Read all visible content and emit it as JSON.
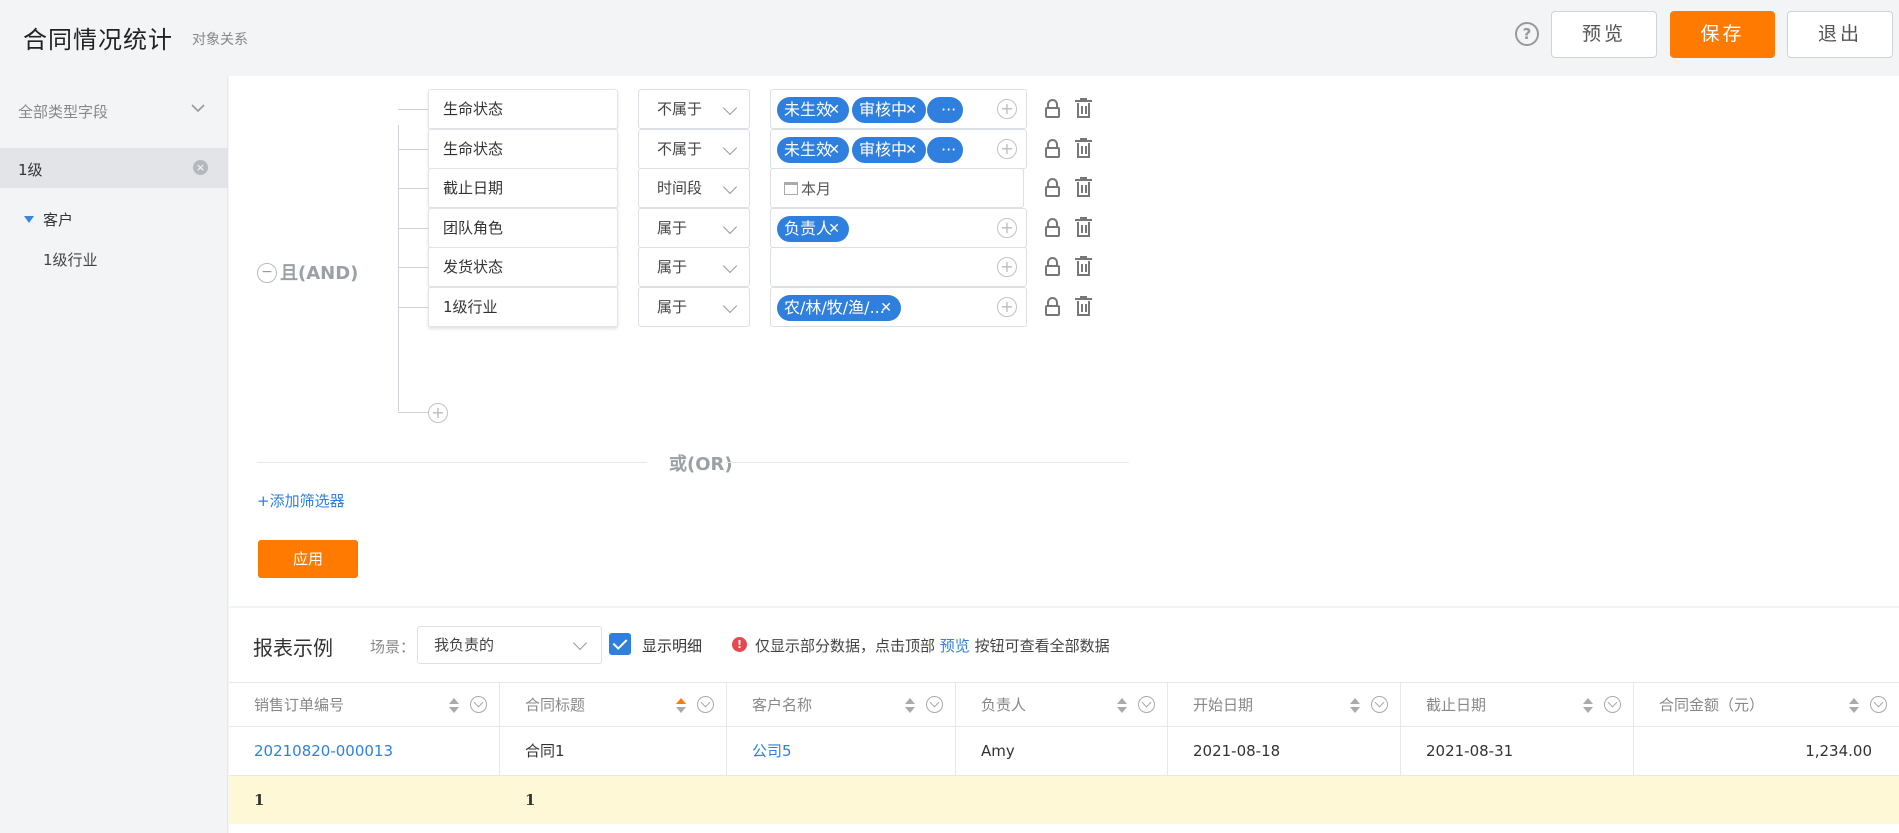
{
  "header": {
    "title": "合同情况统计",
    "subtitle": "对象关系",
    "help_icon": "?",
    "preview_label": "预览",
    "save_label": "保存",
    "exit_label": "退出"
  },
  "sidebar": {
    "field_type_label": "全部类型字段",
    "level_label": "1级",
    "tree": {
      "parent": "客户",
      "child": "1级行业"
    }
  },
  "filter": {
    "group_operator": "且(AND)",
    "rows": [
      {
        "field": "生命状态",
        "operator": "不属于",
        "tags": [
          "未生效",
          "审核中",
          "···"
        ]
      },
      {
        "field": "生命状态",
        "operator": "不属于",
        "tags": [
          "未生效",
          "审核中",
          "···"
        ]
      },
      {
        "field": "截止日期",
        "operator": "时间段",
        "date_value": "本月"
      },
      {
        "field": "团队角色",
        "operator": "属于",
        "tags": [
          "负责人"
        ]
      },
      {
        "field": "发货状态",
        "operator": "属于",
        "tags": []
      },
      {
        "field": "1级行业",
        "operator": "属于",
        "tags": [
          "农/林/牧/渔/..."
        ]
      }
    ],
    "or_label": "或(OR)",
    "add_filter_label": "+添加筛选器",
    "apply_label": "应用"
  },
  "report": {
    "title": "报表示例",
    "scene_label": "场景：",
    "scene_value": "我负责的",
    "show_detail_label": "显示明细",
    "show_detail_checked": true,
    "notice_before": "仅显示部分数据，点击顶部",
    "notice_link": "预览",
    "notice_after": "按钮可查看全部数据",
    "columns": [
      "销售订单编号",
      "合同标题",
      "客户名称",
      "负责人",
      "开始日期",
      "截止日期",
      "合同金额（元）"
    ],
    "rows": [
      [
        "20210820-000013",
        "合同1",
        "公司5",
        "Amy",
        "2021-08-18",
        "2021-08-31",
        "1,234.00"
      ]
    ],
    "summary": [
      "1",
      "1"
    ]
  },
  "colors": {
    "accent": "#ff7a00",
    "link": "#2f7fde",
    "tag": "#2f7fde",
    "summary_bg": "#fff8d6"
  }
}
